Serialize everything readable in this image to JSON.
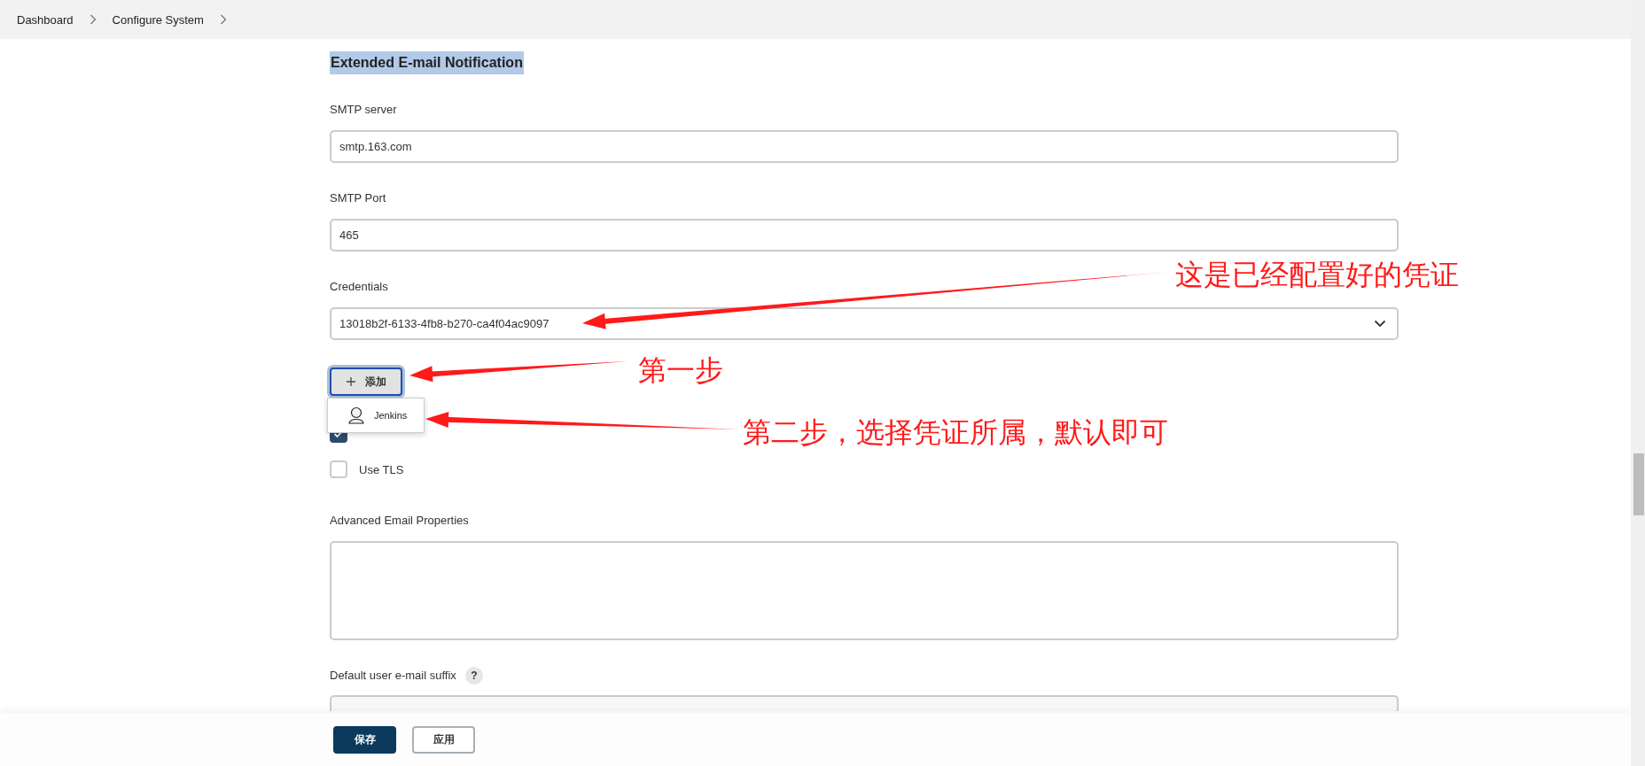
{
  "breadcrumbs": [
    {
      "label": "Dashboard"
    },
    {
      "label": "Configure System"
    }
  ],
  "section": {
    "title": "Extended E-mail Notification",
    "highlighted": true
  },
  "fields": [
    {
      "kind": "text",
      "label": "SMTP server",
      "value": "smtp.163.com"
    },
    {
      "kind": "text",
      "label": "SMTP Port",
      "value": "465"
    },
    {
      "kind": "select",
      "label": "Credentials",
      "value": "13018b2f-6133-4fb8-b270-ca4f04ac9097"
    }
  ],
  "add_button": {
    "label": "添加",
    "focused": true
  },
  "add_menu": {
    "items": [
      {
        "label": "Jenkins"
      }
    ]
  },
  "checkboxes": [
    {
      "checked": true
    },
    {
      "label": "Use TLS",
      "checked": false
    }
  ],
  "advanced": {
    "label": "Advanced Email Properties"
  },
  "suffix": {
    "label": "Default user e-mail suffix",
    "help": "?"
  },
  "bottom_buttons": [
    {
      "label": "保存",
      "kind": "primary"
    },
    {
      "label": "应用",
      "kind": "secondary"
    }
  ],
  "annotations": [
    {
      "text": "这是已经配置好的凭证"
    },
    {
      "text": "第一步"
    },
    {
      "text": "第二步，选择凭证所属，默认即可"
    }
  ]
}
